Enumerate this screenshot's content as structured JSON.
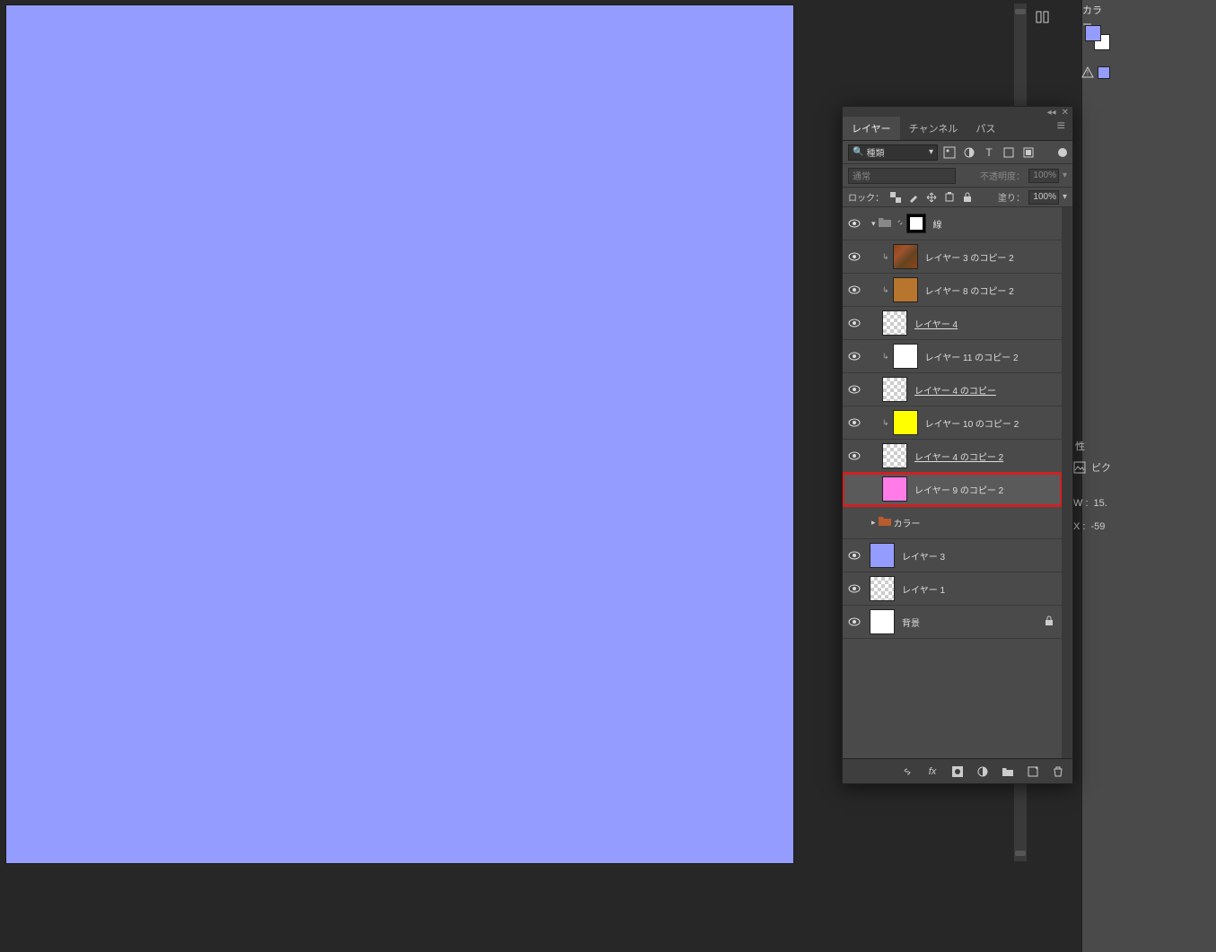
{
  "color_panel": {
    "title": "カラー"
  },
  "properties": {
    "tab": "性",
    "pic_label": "ピク",
    "w_label": "W :",
    "w_value": "15.",
    "x_label": "X :",
    "x_value": "-59"
  },
  "layers_panel": {
    "tabs": {
      "layers": "レイヤー",
      "channels": "チャンネル",
      "paths": "パス"
    },
    "filter_label": "種類",
    "blend_mode": "通常",
    "opacity_label": "不透明度：",
    "opacity_value": "100%",
    "lock_label": "ロック：",
    "fill_label": "塗り：",
    "fill_value": "100%",
    "layers": [
      {
        "id": "grp-lines",
        "name": "線",
        "type": "group",
        "visible": true,
        "mask": true,
        "indent": 0
      },
      {
        "id": "l3c2",
        "name": "レイヤー 3 のコピー 2",
        "type": "layer",
        "visible": true,
        "clip": true,
        "indent": 1,
        "thumb": "tex"
      },
      {
        "id": "l8c2",
        "name": "レイヤー 8 のコピー 2",
        "type": "layer",
        "visible": true,
        "clip": true,
        "indent": 1,
        "thumb": "#b8752e"
      },
      {
        "id": "l4",
        "name": "レイヤー 4",
        "type": "layer",
        "visible": true,
        "indent": 1,
        "thumb": "checker",
        "underline": true
      },
      {
        "id": "l11c2",
        "name": "レイヤー 11 のコピー 2",
        "type": "layer",
        "visible": true,
        "clip": true,
        "indent": 1,
        "thumb": "#ffffff"
      },
      {
        "id": "l4c",
        "name": "レイヤー 4 のコピー",
        "type": "layer",
        "visible": true,
        "indent": 1,
        "thumb": "checker",
        "underline": true
      },
      {
        "id": "l10c2",
        "name": "レイヤー 10 のコピー 2",
        "type": "layer",
        "visible": true,
        "clip": true,
        "indent": 1,
        "thumb": "#ffff00"
      },
      {
        "id": "l4c2",
        "name": "レイヤー 4 のコピー 2",
        "type": "layer",
        "visible": true,
        "indent": 1,
        "thumb": "checker",
        "underline": true
      },
      {
        "id": "l9c2",
        "name": "レイヤー 9 のコピー 2",
        "type": "layer",
        "visible": false,
        "indent": 1,
        "thumb": "#ff7ce8",
        "highlight": true,
        "selected": true
      },
      {
        "id": "grp-color",
        "name": "カラー",
        "type": "group",
        "visible": false,
        "indent": 0,
        "color_folder": true
      },
      {
        "id": "l3",
        "name": "レイヤー 3",
        "type": "layer",
        "visible": true,
        "indent": 0,
        "thumb": "#949cff"
      },
      {
        "id": "l1",
        "name": "レイヤー 1",
        "type": "layer",
        "visible": true,
        "indent": 0,
        "thumb": "checker"
      },
      {
        "id": "bg",
        "name": "背景",
        "type": "layer",
        "visible": true,
        "indent": 0,
        "thumb": "#ffffff",
        "locked": true
      }
    ]
  }
}
